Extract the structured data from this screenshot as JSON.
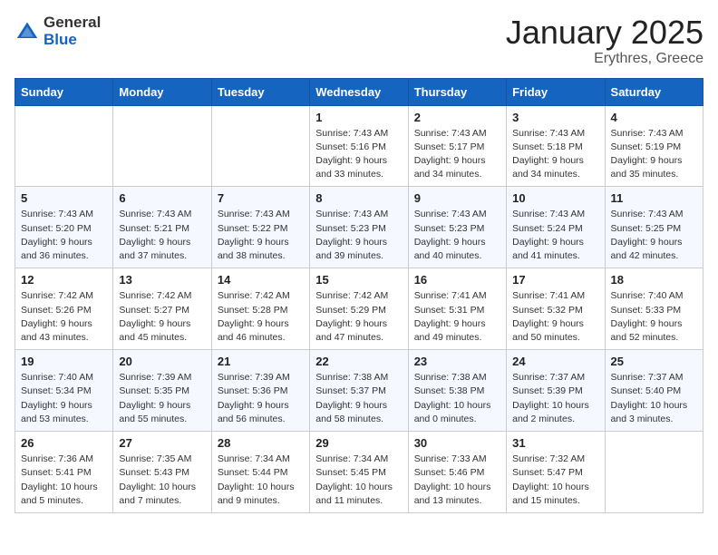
{
  "header": {
    "logo_general": "General",
    "logo_blue": "Blue",
    "month_year": "January 2025",
    "location": "Erythres, Greece"
  },
  "columns": [
    "Sunday",
    "Monday",
    "Tuesday",
    "Wednesday",
    "Thursday",
    "Friday",
    "Saturday"
  ],
  "weeks": [
    [
      {
        "day": "",
        "info": ""
      },
      {
        "day": "",
        "info": ""
      },
      {
        "day": "",
        "info": ""
      },
      {
        "day": "1",
        "info": "Sunrise: 7:43 AM\nSunset: 5:16 PM\nDaylight: 9 hours and 33 minutes."
      },
      {
        "day": "2",
        "info": "Sunrise: 7:43 AM\nSunset: 5:17 PM\nDaylight: 9 hours and 34 minutes."
      },
      {
        "day": "3",
        "info": "Sunrise: 7:43 AM\nSunset: 5:18 PM\nDaylight: 9 hours and 34 minutes."
      },
      {
        "day": "4",
        "info": "Sunrise: 7:43 AM\nSunset: 5:19 PM\nDaylight: 9 hours and 35 minutes."
      }
    ],
    [
      {
        "day": "5",
        "info": "Sunrise: 7:43 AM\nSunset: 5:20 PM\nDaylight: 9 hours and 36 minutes."
      },
      {
        "day": "6",
        "info": "Sunrise: 7:43 AM\nSunset: 5:21 PM\nDaylight: 9 hours and 37 minutes."
      },
      {
        "day": "7",
        "info": "Sunrise: 7:43 AM\nSunset: 5:22 PM\nDaylight: 9 hours and 38 minutes."
      },
      {
        "day": "8",
        "info": "Sunrise: 7:43 AM\nSunset: 5:23 PM\nDaylight: 9 hours and 39 minutes."
      },
      {
        "day": "9",
        "info": "Sunrise: 7:43 AM\nSunset: 5:23 PM\nDaylight: 9 hours and 40 minutes."
      },
      {
        "day": "10",
        "info": "Sunrise: 7:43 AM\nSunset: 5:24 PM\nDaylight: 9 hours and 41 minutes."
      },
      {
        "day": "11",
        "info": "Sunrise: 7:43 AM\nSunset: 5:25 PM\nDaylight: 9 hours and 42 minutes."
      }
    ],
    [
      {
        "day": "12",
        "info": "Sunrise: 7:42 AM\nSunset: 5:26 PM\nDaylight: 9 hours and 43 minutes."
      },
      {
        "day": "13",
        "info": "Sunrise: 7:42 AM\nSunset: 5:27 PM\nDaylight: 9 hours and 45 minutes."
      },
      {
        "day": "14",
        "info": "Sunrise: 7:42 AM\nSunset: 5:28 PM\nDaylight: 9 hours and 46 minutes."
      },
      {
        "day": "15",
        "info": "Sunrise: 7:42 AM\nSunset: 5:29 PM\nDaylight: 9 hours and 47 minutes."
      },
      {
        "day": "16",
        "info": "Sunrise: 7:41 AM\nSunset: 5:31 PM\nDaylight: 9 hours and 49 minutes."
      },
      {
        "day": "17",
        "info": "Sunrise: 7:41 AM\nSunset: 5:32 PM\nDaylight: 9 hours and 50 minutes."
      },
      {
        "day": "18",
        "info": "Sunrise: 7:40 AM\nSunset: 5:33 PM\nDaylight: 9 hours and 52 minutes."
      }
    ],
    [
      {
        "day": "19",
        "info": "Sunrise: 7:40 AM\nSunset: 5:34 PM\nDaylight: 9 hours and 53 minutes."
      },
      {
        "day": "20",
        "info": "Sunrise: 7:39 AM\nSunset: 5:35 PM\nDaylight: 9 hours and 55 minutes."
      },
      {
        "day": "21",
        "info": "Sunrise: 7:39 AM\nSunset: 5:36 PM\nDaylight: 9 hours and 56 minutes."
      },
      {
        "day": "22",
        "info": "Sunrise: 7:38 AM\nSunset: 5:37 PM\nDaylight: 9 hours and 58 minutes."
      },
      {
        "day": "23",
        "info": "Sunrise: 7:38 AM\nSunset: 5:38 PM\nDaylight: 10 hours and 0 minutes."
      },
      {
        "day": "24",
        "info": "Sunrise: 7:37 AM\nSunset: 5:39 PM\nDaylight: 10 hours and 2 minutes."
      },
      {
        "day": "25",
        "info": "Sunrise: 7:37 AM\nSunset: 5:40 PM\nDaylight: 10 hours and 3 minutes."
      }
    ],
    [
      {
        "day": "26",
        "info": "Sunrise: 7:36 AM\nSunset: 5:41 PM\nDaylight: 10 hours and 5 minutes."
      },
      {
        "day": "27",
        "info": "Sunrise: 7:35 AM\nSunset: 5:43 PM\nDaylight: 10 hours and 7 minutes."
      },
      {
        "day": "28",
        "info": "Sunrise: 7:34 AM\nSunset: 5:44 PM\nDaylight: 10 hours and 9 minutes."
      },
      {
        "day": "29",
        "info": "Sunrise: 7:34 AM\nSunset: 5:45 PM\nDaylight: 10 hours and 11 minutes."
      },
      {
        "day": "30",
        "info": "Sunrise: 7:33 AM\nSunset: 5:46 PM\nDaylight: 10 hours and 13 minutes."
      },
      {
        "day": "31",
        "info": "Sunrise: 7:32 AM\nSunset: 5:47 PM\nDaylight: 10 hours and 15 minutes."
      },
      {
        "day": "",
        "info": ""
      }
    ]
  ]
}
